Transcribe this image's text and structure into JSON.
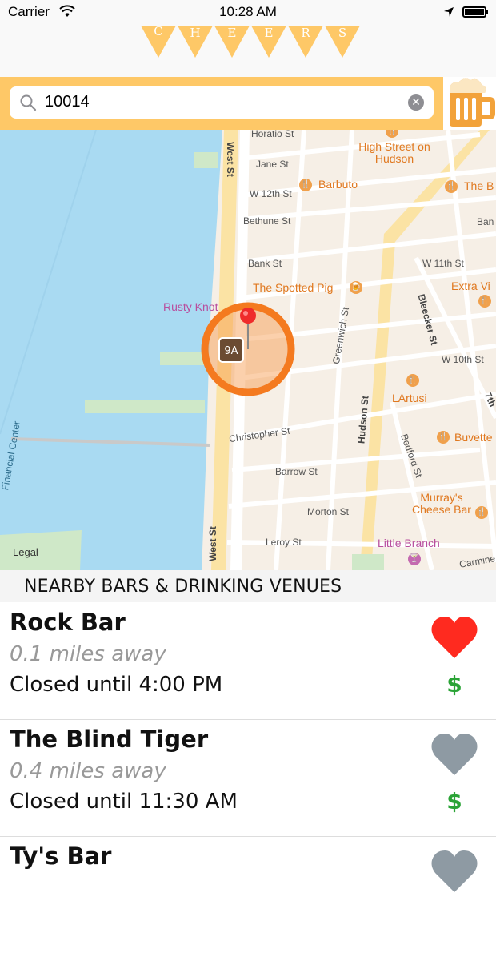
{
  "status": {
    "carrier": "Carrier",
    "time": "10:28 AM"
  },
  "banner": {
    "letters": [
      "C",
      "H",
      "E",
      "E",
      "R",
      "S"
    ],
    "flag_color": "#fec867"
  },
  "search": {
    "value": "10014",
    "clear_icon": "close-icon"
  },
  "map": {
    "streets": [
      "Horatio St",
      "Jane St",
      "W 12th St",
      "Bethune St",
      "Bank St",
      "W 11th St",
      "W 10th St",
      "Christopher St",
      "Barrow St",
      "Morton St",
      "Leroy St",
      "Carmine",
      "West St",
      "Greenwich St",
      "Bleecker St",
      "Hudson St",
      "Bedford St",
      "7th",
      "Ban",
      "Financial Center"
    ],
    "places": [
      "High Street on Hudson",
      "Barbuto",
      "The B",
      "The Spotted Pig",
      "Extra Vi",
      "Rusty Knot",
      "LArtusi",
      "Buvette",
      "Murray's Cheese Bar",
      "Little Branch"
    ],
    "route_badge": "9A",
    "legal": "Legal"
  },
  "section_title": "NEARBY BARS & DRINKING VENUES",
  "venues": [
    {
      "name": "Rock Bar",
      "distance": "0.1 miles away",
      "hours": "Closed until 4:00 PM",
      "price": "$",
      "favorite": true
    },
    {
      "name": "The Blind Tiger",
      "distance": "0.4 miles away",
      "hours": "Closed until 11:30 AM",
      "price": "$",
      "favorite": false
    },
    {
      "name": "Ty's Bar",
      "distance": "",
      "hours": "",
      "price": "",
      "favorite": false
    }
  ],
  "colors": {
    "accent": "#fec867",
    "heart_active": "#ff2a1f",
    "heart_inactive": "#8e9aa3",
    "price": "#2aa336",
    "location_ring": "#f47a1f"
  }
}
